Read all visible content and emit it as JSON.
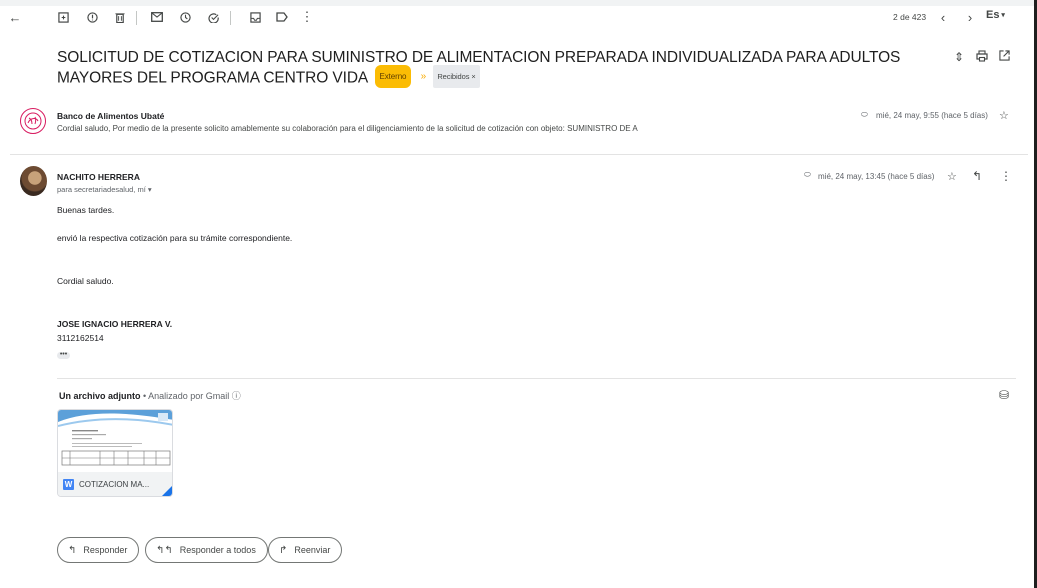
{
  "toolbar": {
    "pager": "2 de 423",
    "lang": "Es"
  },
  "thread": {
    "subject": "SOLICITUD DE COTIZACION PARA SUMINISTRO DE ALIMENTACION PREPARADA INDIVIDUALIZADA PARA ADULTOS MAYORES DEL PROGRAMA CENTRO VIDA",
    "badge_external": "Externo",
    "label_inbox": "Recibidos ×"
  },
  "message1": {
    "sender": "Banco de Alimentos Ubaté",
    "snippet": "Cordial saludo, Por medio de la presente solicito amablemente su colaboración para el diligenciamiento de la solicitud de cotización con objeto: SUMINISTRO DE A",
    "date": "mié, 24 may, 9:55 (hace 5 días)"
  },
  "message2": {
    "sender": "NACHITO HERRERA",
    "to": "para secretariadesalud, mí",
    "date": "mié, 24 may, 13:45 (hace 5 días)",
    "body": {
      "greeting": "Buenas tardes.",
      "line1": "envió la respectiva cotización para su trámite correspondiente.",
      "closing": "Cordial saludo.",
      "sig_name": "JOSE IGNACIO HERRERA V.",
      "sig_phone": "3112162514"
    }
  },
  "attachments": {
    "count_label": "Un archivo adjunto",
    "scanned_label": " • Analizado por Gmail ⓘ",
    "items": [
      {
        "name": "COTIZACION MA...",
        "type_letter": "W",
        "type_color": "#4285f4"
      }
    ]
  },
  "actions": {
    "reply": "Responder",
    "reply_all": "Responder a todos",
    "forward": "Reenviar"
  },
  "colors": {
    "external_badge": "#fbbc04",
    "accent_blue": "#1a73e8",
    "avatar_ring": "#d81b60"
  }
}
